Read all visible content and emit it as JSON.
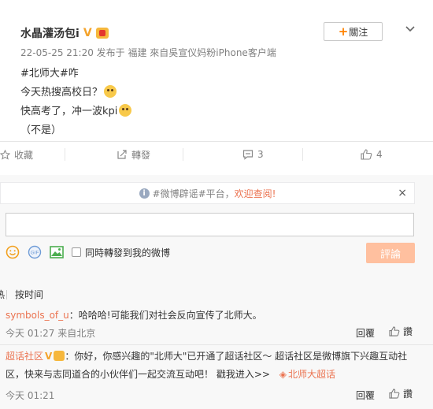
{
  "post": {
    "username": "水晶灌汤包i",
    "follow_label": "關注",
    "meta": "22-05-25 21:20 发布于 福建 來自吳宣仪妈粉iPhone客户端",
    "lines": [
      "#北师大#咋",
      "今天热搜高校日？",
      "快高考了，冲一波kpi",
      "（不是）"
    ]
  },
  "actions": {
    "favorite": "收藏",
    "repost": "轉發",
    "comment_count": "3",
    "like_count": "4"
  },
  "notice": {
    "text": "#微博辟谣#平台，",
    "link": "欢迎查阅!",
    "close": "×"
  },
  "composer": {
    "repost_label": "同時轉發到我的微博",
    "submit_label": "評論"
  },
  "sort": {
    "hot": "热",
    "time": "按时间"
  },
  "comments": [
    {
      "username": "symbols_of_u",
      "text": "：哈哈哈!可能我们对社会反向宣传了北师大。",
      "time": "今天 01:27 来自北京",
      "reply": "回覆",
      "like": "讚"
    },
    {
      "username": "超话社区",
      "text_1": "：你好，你感兴趣的\"北师大\"已开通了超话社区～ 超话社区是微博旗下兴趣互动社",
      "text_2": "区，快来与志同道合的小伙伴们一起交流互动吧！ 戳我进入>>",
      "topic": "北师大超话",
      "time": "今天 01:21",
      "reply": "回覆",
      "like": "讚"
    }
  ]
}
